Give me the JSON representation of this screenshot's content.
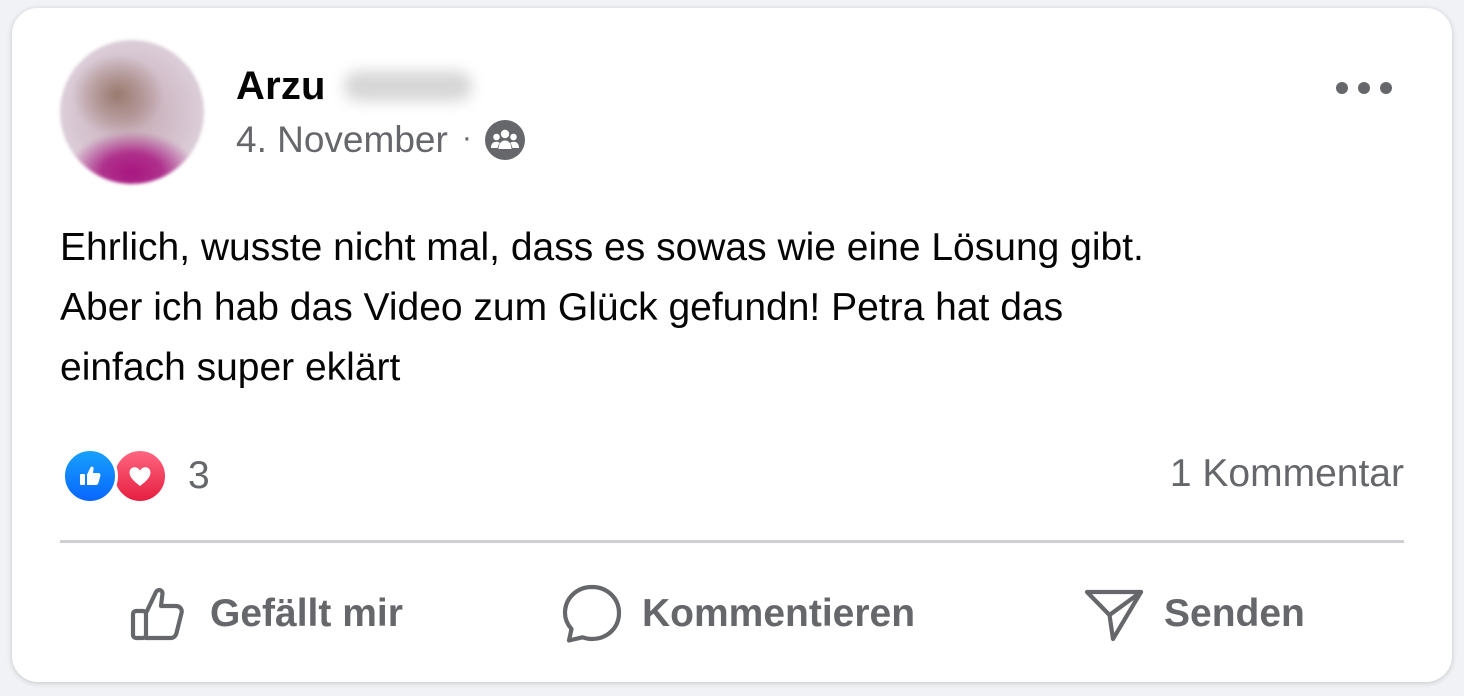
{
  "post": {
    "author_first_name": "Arzu",
    "date": "4. November",
    "separator": "·",
    "audience_icon": "group-icon",
    "text_lines": [
      "Ehrlich, wusste nicht mal, dass es sowas wie eine Lösung gibt.",
      "Aber ich hab das Video zum Glück gefundn! Petra hat das",
      "einfach super eklärt"
    ]
  },
  "reactions": {
    "types": [
      "like-icon",
      "love-icon"
    ],
    "count": "3",
    "comments_label": "1 Kommentar"
  },
  "actions": {
    "like_label": "Gefällt mir",
    "comment_label": "Kommentieren",
    "share_label": "Senden"
  },
  "colors": {
    "text_primary": "#050505",
    "text_secondary": "#65676b",
    "like_blue": "#0866ff",
    "love_red": "#e61e40",
    "divider": "#ced0d4"
  }
}
